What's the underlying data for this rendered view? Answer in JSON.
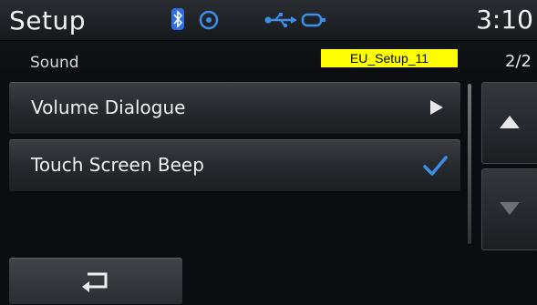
{
  "header": {
    "title": "Setup",
    "clock": "3:10",
    "icons": [
      "bluetooth-icon",
      "media-icon",
      "usb-icon",
      "ipod-icon"
    ]
  },
  "subheader": {
    "section": "Sound",
    "page_indicator": "2/2",
    "tag": "EU_Setup_11"
  },
  "menu": {
    "items": [
      {
        "label": "Volume Dialogue",
        "accessory": "arrow-right-icon"
      },
      {
        "label": "Touch Screen Beep",
        "accessory": "checkmark-icon",
        "checked": true
      }
    ]
  },
  "controls": {
    "scroll_up": "arrow-up-icon",
    "scroll_down": "arrow-down-icon",
    "back": "back-arrow-icon"
  },
  "colors": {
    "accent_check": "#3b8fe8",
    "bluetooth": "#2f6fe0",
    "tag_background": "#ffff00"
  }
}
